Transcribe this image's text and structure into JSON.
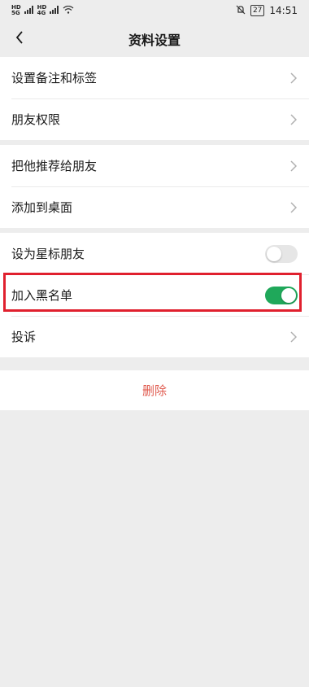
{
  "status_bar": {
    "hd1": "HD",
    "signal1": "5G",
    "hd2": "HD",
    "signal2": "4G",
    "battery": "27",
    "time": "14:51"
  },
  "header": {
    "title": "资料设置"
  },
  "groups": {
    "g1": [
      "设置备注和标签",
      "朋友权限"
    ],
    "g2": [
      "把他推荐给朋友",
      "添加到桌面"
    ],
    "g3": {
      "star_label": "设为星标朋友",
      "blacklist_label": "加入黑名单",
      "complain_label": "投诉"
    }
  },
  "toggles": {
    "star_friend": "off",
    "blacklist": "on"
  },
  "delete_label": "删除",
  "colors": {
    "accent_green": "#1fa85a",
    "highlight_red": "#e0202e",
    "delete_red": "#e05a4e"
  }
}
